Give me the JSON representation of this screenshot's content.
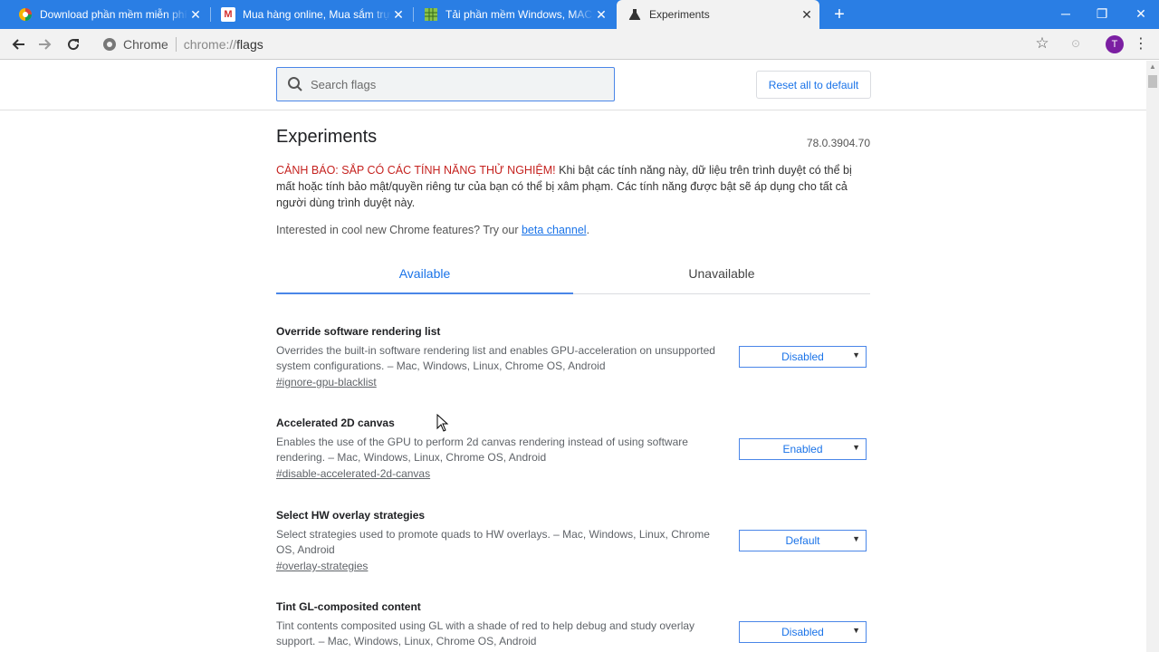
{
  "browser": {
    "tabs": [
      {
        "title": "Download phần mềm miễn phí c",
        "favicon": "download-site-icon"
      },
      {
        "title": "Mua hàng online, Mua sắm trực",
        "favicon": "m-store-icon"
      },
      {
        "title": "Tải phần mềm Windows, MAC, A",
        "favicon": "grid-site-icon"
      },
      {
        "title": "Experiments",
        "favicon": "flask-icon",
        "active": true
      }
    ],
    "new_tab": "+",
    "window_controls": {
      "minimize": "─",
      "restore": "❐",
      "close": "✕"
    }
  },
  "toolbar": {
    "chip": "Chrome",
    "url_scheme": "chrome://",
    "url_path": "flags",
    "avatar_letter": "T"
  },
  "flags": {
    "search_placeholder": "Search flags",
    "reset_label": "Reset all to default",
    "title": "Experiments",
    "version": "78.0.3904.70",
    "warning_red": "CẢNH BÁO: SẮP CÓ CÁC TÍNH NĂNG THỬ NGHIỆM!",
    "warning_text": " Khi bật các tính năng này, dữ liệu trên trình duyệt có thể bị mất hoặc tính bảo mật/quyền riêng tư của bạn có thể bị xâm phạm. Các tính năng được bật sẽ áp dụng cho tất cả người dùng trình duyệt này.",
    "interest_text": "Interested in cool new Chrome features? Try our ",
    "interest_link": "beta channel",
    "interest_end": ".",
    "tab_available": "Available",
    "tab_unavailable": "Unavailable",
    "experiments": [
      {
        "name": "Override software rendering list",
        "desc": "Overrides the built-in software rendering list and enables GPU-acceleration on unsupported system configurations. – Mac, Windows, Linux, Chrome OS, Android",
        "link": "#ignore-gpu-blacklist",
        "value": "Disabled"
      },
      {
        "name": "Accelerated 2D canvas",
        "desc": "Enables the use of the GPU to perform 2d canvas rendering instead of using software rendering. – Mac, Windows, Linux, Chrome OS, Android",
        "link": "#disable-accelerated-2d-canvas",
        "value": "Enabled"
      },
      {
        "name": "Select HW overlay strategies",
        "desc": "Select strategies used to promote quads to HW overlays. – Mac, Windows, Linux, Chrome OS, Android",
        "link": "#overlay-strategies",
        "value": "Default"
      },
      {
        "name": "Tint GL-composited content",
        "desc": "Tint contents composited using GL with a shade of red to help debug and study overlay support. – Mac, Windows, Linux, Chrome OS, Android",
        "link": "",
        "value": "Disabled"
      }
    ]
  },
  "colors": {
    "accent": "#1a73e8",
    "tabstrip": "#2a7ee4",
    "warning": "#c5221f"
  }
}
